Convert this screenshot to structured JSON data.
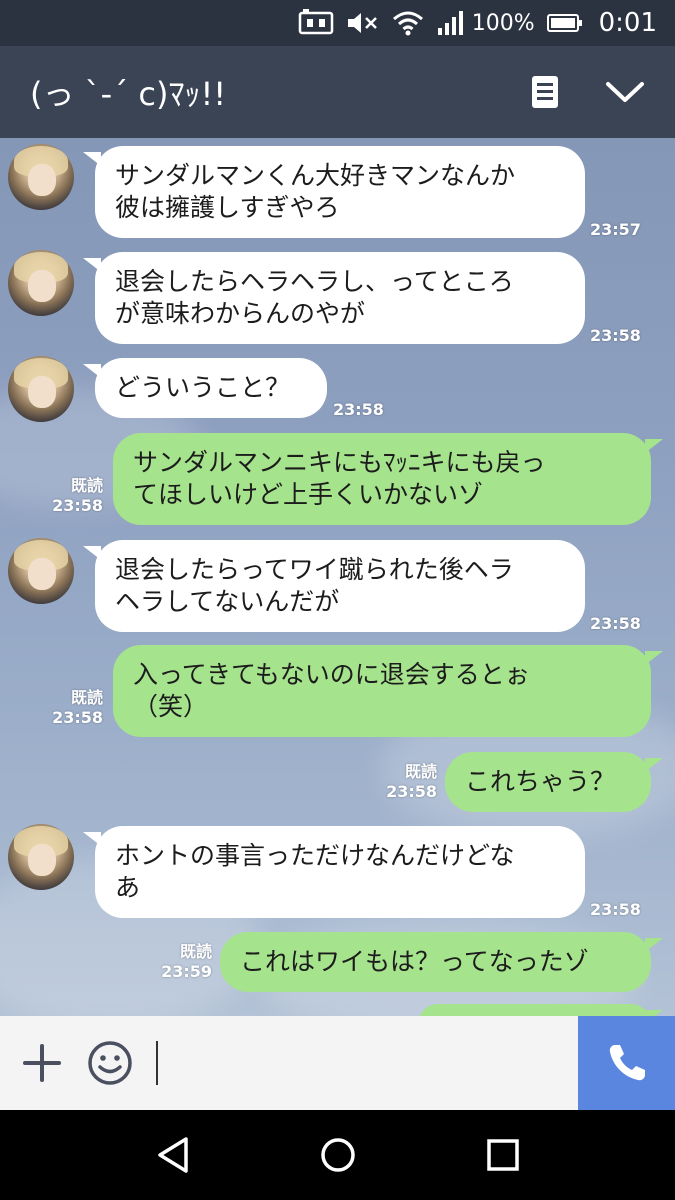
{
  "status_bar": {
    "battery_percent": "100%",
    "time": "0:01"
  },
  "header": {
    "title": "(っ `-´ c)ﾏｯ!!"
  },
  "messages": [
    {
      "side": "in",
      "lines": [
        "サンダルマンくん大好きマンなんか",
        "彼は擁護しすぎやろ"
      ],
      "time": "23:57"
    },
    {
      "side": "in",
      "lines": [
        "退会したらヘラヘラし、ってところ",
        "が意味わからんのやが"
      ],
      "time": "23:58"
    },
    {
      "side": "in",
      "lines": [
        "どういうこと？"
      ],
      "time": "23:58"
    },
    {
      "side": "out",
      "lines": [
        "サンダルマンニキにもﾏｯﾆキにも戻っ",
        "てほしいけど上手くいかないゾ"
      ],
      "read": "既読",
      "time": "23:58"
    },
    {
      "side": "in",
      "lines": [
        "退会したらってワイ蹴られた後ヘラ",
        "ヘラしてないんだが"
      ],
      "time": "23:58"
    },
    {
      "side": "out",
      "lines": [
        "入ってきてもないのに退会するとぉ",
        "（笑）"
      ],
      "read": "既読",
      "time": "23:58"
    },
    {
      "side": "out",
      "lines": [
        "これちゃう？"
      ],
      "read": "既読",
      "time": "23:58"
    },
    {
      "side": "in",
      "lines": [
        "ホントの事言っただけなんだけどな",
        "あ"
      ],
      "time": "23:58"
    },
    {
      "side": "out",
      "lines": [
        "これはワイもは？ってなったゾ"
      ],
      "read": "既読",
      "time": "23:59"
    }
  ],
  "input": {
    "value": ""
  },
  "colors": {
    "header_bg": "#3b4455",
    "outgoing_bubble": "#a6e38d",
    "incoming_bubble": "#ffffff",
    "call_button": "#5b86df"
  }
}
